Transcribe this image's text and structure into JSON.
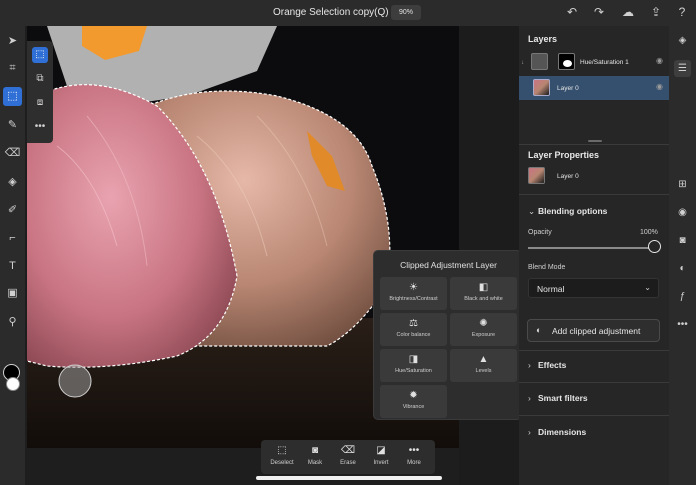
{
  "document": {
    "title": "Orange Selection copy(Q) *",
    "zoom": "90%"
  },
  "topbar_icons": [
    "undo-icon",
    "redo-icon",
    "cloud-icon",
    "share-icon",
    "help-icon"
  ],
  "toolbar": {
    "tools": [
      "move-icon",
      "transform-icon",
      "selection-icon",
      "brush-icon",
      "eraser-icon",
      "fill-icon",
      "healing-icon",
      "crop-icon",
      "type-icon",
      "place-image-icon",
      "eyedropper-icon"
    ],
    "active_tool": "selection-icon",
    "foreground_color": "#000000",
    "background_color": "#ffffff"
  },
  "selection_bar": {
    "items": [
      {
        "label": "Deselect",
        "icon": "deselect-icon"
      },
      {
        "label": "Mask",
        "icon": "mask-icon"
      },
      {
        "label": "Erase",
        "icon": "erase-icon"
      },
      {
        "label": "Invert",
        "icon": "invert-icon"
      },
      {
        "label": "More",
        "icon": "more-icon"
      }
    ]
  },
  "clipped_popup": {
    "title": "Clipped Adjustment Layer",
    "items": [
      {
        "label": "Brightness/Contrast",
        "icon": "sun-icon"
      },
      {
        "label": "Black and white",
        "icon": "half-square-icon"
      },
      {
        "label": "Color balance",
        "icon": "balance-icon"
      },
      {
        "label": "Exposure",
        "icon": "aperture-icon"
      },
      {
        "label": "Hue/Saturation",
        "icon": "hue-icon"
      },
      {
        "label": "Levels",
        "icon": "levels-icon"
      },
      {
        "label": "Vibrance",
        "icon": "vibrance-icon"
      }
    ]
  },
  "layers_panel": {
    "title": "Layers",
    "layers": [
      {
        "name": "Hue/Saturation 1",
        "selected": false
      },
      {
        "name": "Layer 0",
        "selected": true
      }
    ]
  },
  "layer_properties": {
    "title": "Layer Properties",
    "layer_name": "Layer 0",
    "blending": {
      "title": "Blending options",
      "opacity_label": "Opacity",
      "opacity_value": "100%",
      "opacity": 1.0,
      "blend_mode_label": "Blend Mode",
      "blend_mode": "Normal"
    },
    "add_clipped_label": "Add clipped adjustment",
    "sections": [
      "Effects",
      "Smart filters",
      "Dimensions"
    ]
  },
  "right_strip_icons": [
    "layers-icon",
    "adjustments-icon",
    "add-layer-icon",
    "visibility-icon",
    "mask-icon",
    "adjustment-layer-icon",
    "fx-icon",
    "more-icon"
  ]
}
